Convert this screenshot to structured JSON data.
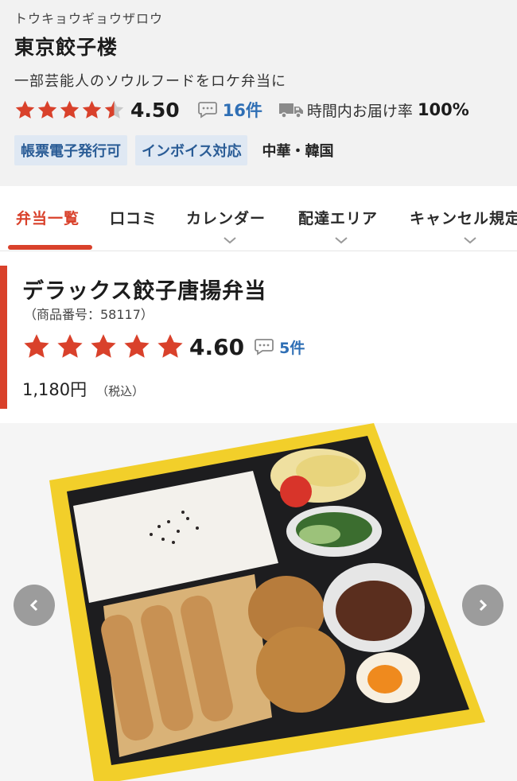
{
  "shop": {
    "kana": "トウキョウギョウザロウ",
    "name": "東京餃子楼",
    "tagline": "一部芸能人のソウルフードをロケ弁当に",
    "rating": "4.50",
    "rating_stars": 4.5,
    "review_count": "16件",
    "delivery_label": "時間内お届け率",
    "delivery_rate": "100%",
    "tags": [
      "帳票電子発行可",
      "インボイス対応"
    ],
    "cuisine": "中華・韓国"
  },
  "tabs": [
    {
      "label": "弁当一覧",
      "active": true
    },
    {
      "label": "口コミ"
    },
    {
      "label": "カレンダー"
    },
    {
      "label": "配達エリア"
    },
    {
      "label": "キャンセル規定"
    }
  ],
  "product": {
    "name": "デラックス餃子唐揚弁当",
    "code": "（商品番号：58117）",
    "rating": "4.60",
    "rating_stars": 5,
    "review_count": "5件",
    "price": "1,180円",
    "tax_note": "（税込）"
  },
  "icons": {
    "star": "star-icon",
    "review": "speech-bubble-icon",
    "delivery": "truck-icon",
    "tab_expand": "chevron-down-icon",
    "gallery_prev": "chevron-left-icon",
    "gallery_next": "chevron-right-icon"
  },
  "colors": {
    "accent": "#d9412b",
    "link": "#2f6fb5",
    "tag_bg": "#dfe8f3",
    "star_empty": "#c8c8c8"
  }
}
